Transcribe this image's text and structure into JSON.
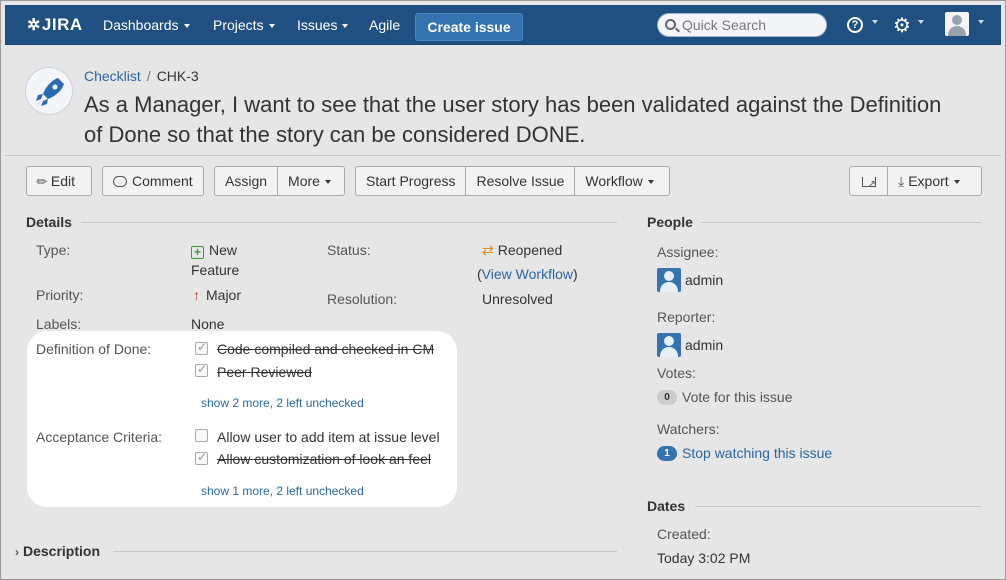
{
  "nav": {
    "logo": "JIRA",
    "items": [
      {
        "label": "Dashboards"
      },
      {
        "label": "Projects"
      },
      {
        "label": "Issues"
      },
      {
        "label": "Agile"
      }
    ],
    "create_label": "Create issue",
    "search_placeholder": "Quick Search"
  },
  "issue": {
    "project": "Checklist",
    "key": "CHK-3",
    "summary": "As a Manager, I want to see that the user story has been validated against the Definition of Done so that the story can be considered DONE."
  },
  "toolbar": {
    "edit": "Edit",
    "comment": "Comment",
    "assign": "Assign",
    "more": "More",
    "start_progress": "Start Progress",
    "resolve_issue": "Resolve Issue",
    "workflow": "Workflow",
    "export": "Export"
  },
  "details": {
    "title": "Details",
    "type_label": "Type:",
    "type_value_line1": "New",
    "type_value_line2": "Feature",
    "status_label": "Status:",
    "status_value": "Reopened",
    "view_workflow": "View Workflow",
    "priority_label": "Priority:",
    "priority_value": "Major",
    "resolution_label": "Resolution:",
    "resolution_value": "Unresolved",
    "labels_label": "Labels:",
    "labels_value": "None",
    "dod_label": "Definition of Done:",
    "dod_items": [
      {
        "text": "Code compiled and checked in CM",
        "checked": true
      },
      {
        "text": "Peer Reviewed",
        "checked": true
      }
    ],
    "dod_more": "show 2 more, 2 left unchecked",
    "ac_label": "Acceptance Criteria:",
    "ac_items": [
      {
        "text": "Allow user to add item at issue level",
        "checked": false
      },
      {
        "text": "Allow customization of look an feel",
        "checked": true
      }
    ],
    "ac_more": "show 1 more, 2 left unchecked"
  },
  "description": {
    "title": "Description"
  },
  "people": {
    "title": "People",
    "assignee_label": "Assignee:",
    "assignee": "admin",
    "reporter_label": "Reporter:",
    "reporter": "admin",
    "votes_label": "Votes:",
    "votes_count": "0",
    "vote_text": "Vote for this issue",
    "watchers_label": "Watchers:",
    "watchers_count": "1",
    "watch_text": "Stop watching this issue"
  },
  "dates": {
    "title": "Dates",
    "created_label": "Created:",
    "created_value": "Today 3:02 PM"
  },
  "colors": {
    "nav_bg": "#205081",
    "link": "#2a67a0",
    "create_btn": "#3572b0"
  }
}
